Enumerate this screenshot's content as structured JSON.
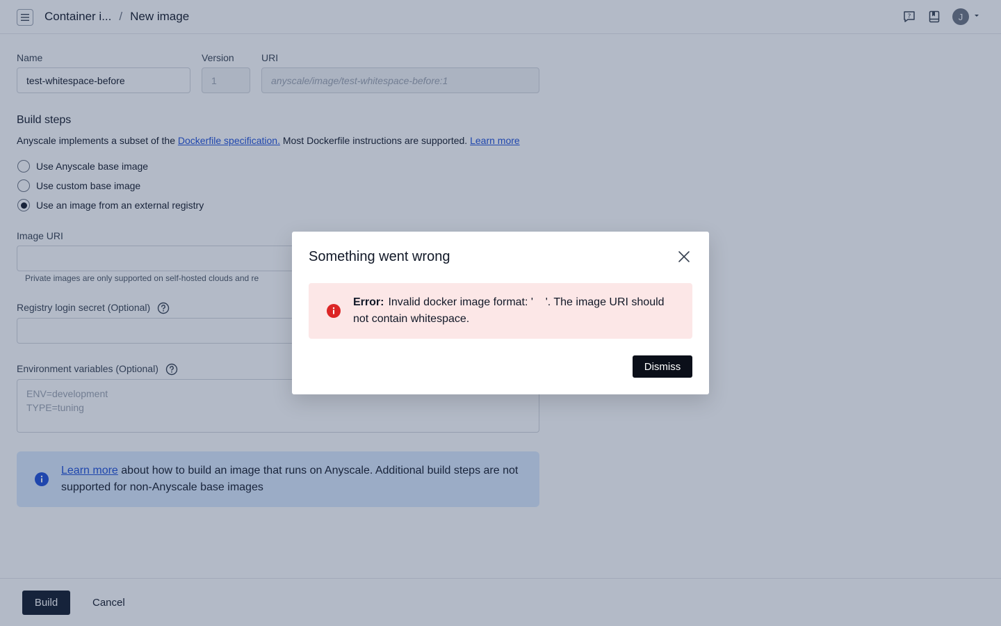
{
  "header": {
    "breadcrumb_parent": "Container i...",
    "breadcrumb_separator": "/",
    "breadcrumb_current": "New image",
    "avatar_initial": "J",
    "icons": [
      "menu-icon",
      "help-chat-icon",
      "docs-book-icon",
      "chevron-down-icon"
    ]
  },
  "form": {
    "name_label": "Name",
    "name_value": "test-whitespace-before",
    "version_label": "Version",
    "version_value": "1",
    "uri_label": "URI",
    "uri_placeholder": "anyscale/image/test-whitespace-before:1",
    "build_steps_title": "Build steps",
    "desc_prefix": "Anyscale implements a subset of the ",
    "desc_link": "Dockerfile specification.",
    "desc_middle": " Most Dockerfile instructions are supported. ",
    "desc_learn_more": "Learn more",
    "radio_options": [
      {
        "label": "Use Anyscale base image",
        "selected": false
      },
      {
        "label": "Use custom base image",
        "selected": false
      },
      {
        "label": "Use an image from an external registry",
        "selected": true
      }
    ],
    "image_uri_label": "Image URI",
    "image_uri_help": "Private images are only supported on self-hosted clouds and re",
    "registry_label": "Registry login secret (Optional)",
    "env_label": "Environment variables (Optional)",
    "env_placeholder_line1": "ENV=development",
    "env_placeholder_line2": "TYPE=tuning",
    "info_link": "Learn more",
    "info_text": " about how to build an image that runs on Anyscale. Additional build steps are not supported for non-Anyscale base images"
  },
  "footer": {
    "build_label": "Build",
    "cancel_label": "Cancel"
  },
  "modal": {
    "title": "Something went wrong",
    "error_label": "Error:",
    "error_message": "Invalid docker image format: '    '. The image URI should not contain whitespace.",
    "dismiss_label": "Dismiss"
  },
  "colors": {
    "primary_button": "#0f1729",
    "link": "#1d4ed8",
    "error_bg": "#fce7e7",
    "error_icon": "#dc2626",
    "info_bg": "#dbeafe",
    "info_icon": "#1d4ed8"
  }
}
